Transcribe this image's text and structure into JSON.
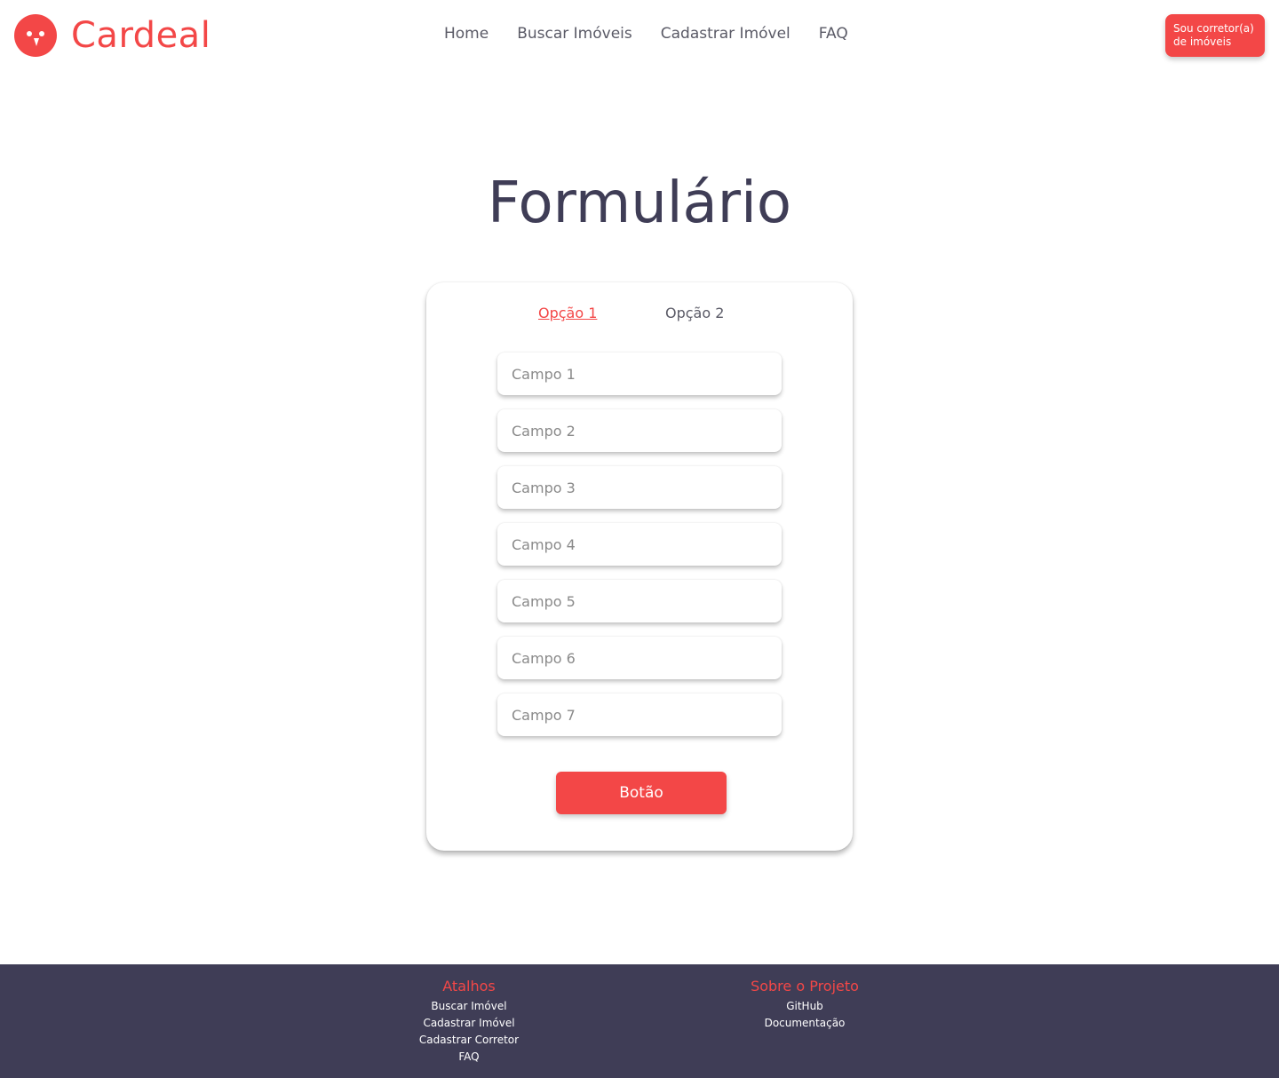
{
  "header": {
    "brand": "Cardeal",
    "nav": [
      "Home",
      "Buscar Imóveis",
      "Cadastrar Imóvel",
      "FAQ"
    ],
    "broker_button": "Sou corretor(a) de imóveis"
  },
  "main": {
    "title": "Formulário",
    "tabs": [
      {
        "label": "Opção 1",
        "active": true
      },
      {
        "label": "Opção 2",
        "active": false
      }
    ],
    "fields": [
      {
        "placeholder": "Campo 1",
        "value": ""
      },
      {
        "placeholder": "Campo 2",
        "value": ""
      },
      {
        "placeholder": "Campo 3",
        "value": ""
      },
      {
        "placeholder": "Campo 4",
        "value": ""
      },
      {
        "placeholder": "Campo 5",
        "value": ""
      },
      {
        "placeholder": "Campo 6",
        "value": ""
      },
      {
        "placeholder": "Campo 7",
        "value": ""
      }
    ],
    "submit_label": "Botão"
  },
  "footer": {
    "shortcuts": {
      "heading": "Atalhos",
      "links": [
        "Buscar Imóvel",
        "Cadastrar Imóvel",
        "Cadastrar Corretor",
        "FAQ"
      ]
    },
    "about": {
      "heading": "Sobre o Projeto",
      "links": [
        "GitHub",
        "Documentação"
      ]
    }
  },
  "colors": {
    "accent": "#f34747",
    "dark": "#3f3d56",
    "background": "#ffffff"
  },
  "icons": {
    "logo": "cardinal-bird-icon"
  }
}
